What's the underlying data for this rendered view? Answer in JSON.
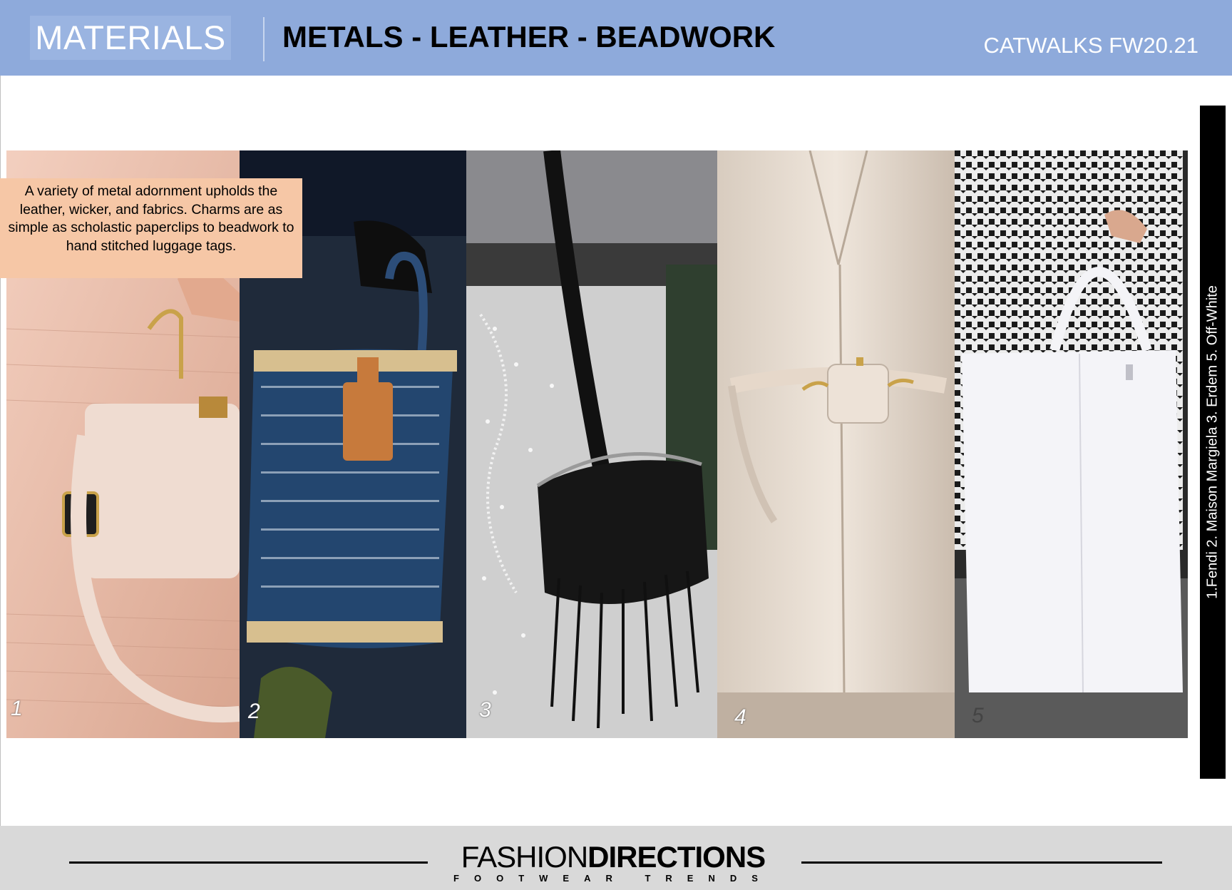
{
  "header": {
    "section": "MATERIALS",
    "title": "METALS - LEATHER - BEADWORK",
    "season": "CATWALKS FW20.21"
  },
  "caption": "A variety of metal adornment upholds the leather, wicker, and fabrics. Charms are as simple as scholastic paperclips to beadwork to hand stitched luggage tags.",
  "photos": [
    {
      "number": "1",
      "subject": "pink-handbag-chain-charm"
    },
    {
      "number": "2",
      "subject": "navy-wicker-basket-bag"
    },
    {
      "number": "3",
      "subject": "black-beaded-clutch"
    },
    {
      "number": "4",
      "subject": "cream-leather-belt-bag"
    },
    {
      "number": "5",
      "subject": "white-leather-tote-paperclip"
    }
  ],
  "credits": "1.Fendi 2. Maison Margiela  3. Erdem 5. Off-White",
  "footer": {
    "brand_light": "FASHION",
    "brand_bold": "DIRECTIONS",
    "brand_sub": "FOOTWEAR TRENDS"
  },
  "colors": {
    "header_bg": "#8eaadb",
    "caption_bg": "#f6c7a6",
    "footer_bg": "#d9d9d9"
  }
}
